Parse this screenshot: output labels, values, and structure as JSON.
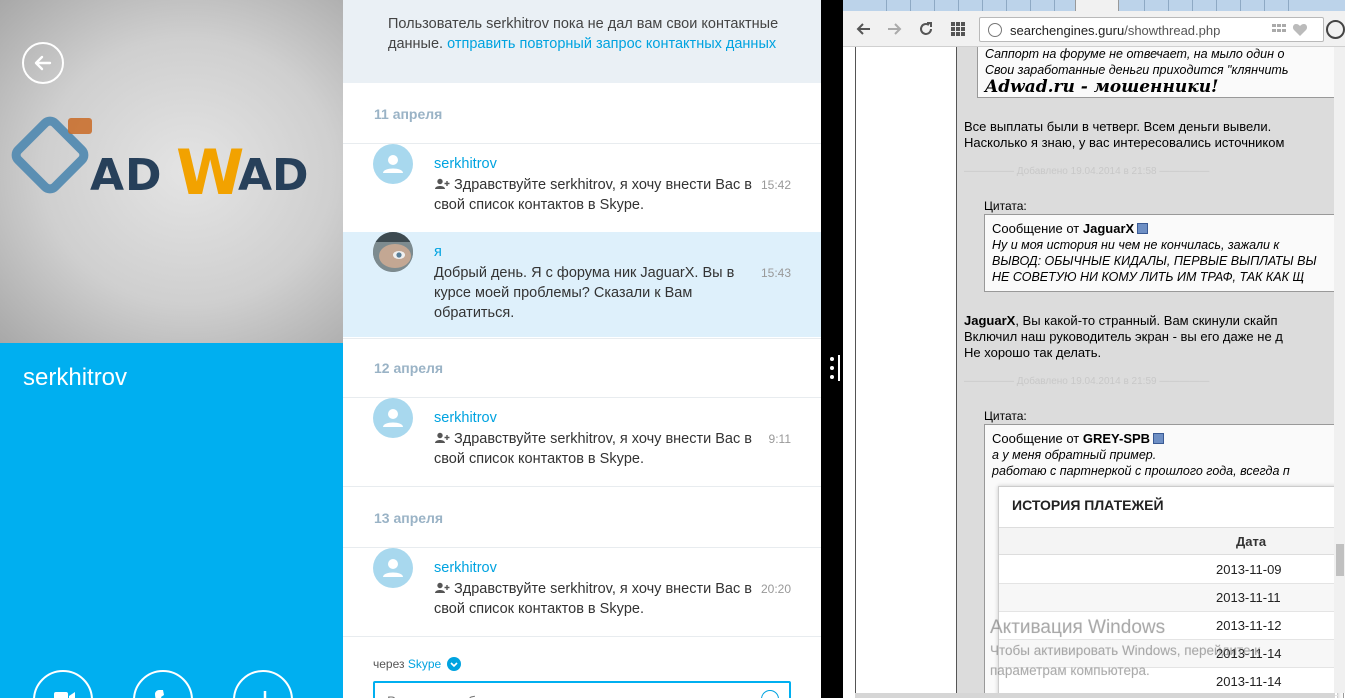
{
  "contact": {
    "name": "serkhitrov",
    "photo_logo_text": "ADWAD"
  },
  "chat": {
    "notice_text": "Пользователь serkhitrov пока не дал вам свои контактные данные.",
    "notice_link": "отправить повторный запрос контактных данных",
    "groups": [
      {
        "date": "11 апреля",
        "messages": [
          {
            "sender": "serkhitrov",
            "text": "Здравствуйте serkhitrov, я хочу внести Вас в свой список контактов в Skype.",
            "time": "15:42"
          },
          {
            "sender": "я",
            "text": "Добрый день. Я с форума ник JaguarX. Вы в курсе моей проблемы? Сказали к Вам обратиться.",
            "time": "15:43"
          }
        ]
      },
      {
        "date": "12 апреля",
        "messages": [
          {
            "sender": "serkhitrov",
            "text": "Здравствуйте serkhitrov, я хочу внести Вас в свой список контактов в Skype.",
            "time": "9:11"
          }
        ]
      },
      {
        "date": "13 апреля",
        "messages": [
          {
            "sender": "serkhitrov",
            "text": "Здравствуйте serkhitrov, я хочу внести Вас в свой список контактов в Skype.",
            "time": "20:20"
          }
        ]
      }
    ],
    "via_label": "через",
    "via_service": "Skype",
    "input_placeholder": "Введите сообщение"
  },
  "browser": {
    "url_domain": "searchengines.guru",
    "url_path": "/showthread.php",
    "post1_line1": "Саппорт на форуме не отвечает, на мыло один о",
    "post1_line2": "Свои заработанные деньги приходится \"клянчить",
    "post1_headline": "Adwad.ru - мошенники!",
    "post2_line1": "Все выплаты были в четверг. Всем деньги вывели.",
    "post2_line2": "Насколько я знаю, у вас интересовались источником",
    "divider1": "Добавлено 19.04.2014 в 21:58",
    "quote_label": "Цитата:",
    "quote1_header_prefix": "Сообщение от",
    "quote1_author": "JaguarX",
    "quote1_line1": "Ну и моя история ни чем не кончилась, зажали к",
    "quote1_line2": "ВЫВОД: ОБЫЧНЫЕ КИДАЛЫ, ПЕРВЫЕ ВЫПЛАТЫ ВЫ",
    "quote1_line3": "НЕ СОВЕТУЮ НИ КОМУ ЛИТЬ ИМ ТРАФ, ТАК КАК Щ",
    "post3_name": "JaguarX",
    "post3_line1_rest": ", Вы какой-то странный. Вам скинули скайп",
    "post3_line2": "Включил наш руководитель экран - вы его даже не д",
    "post3_line3": "Не хорошо так делать.",
    "divider2": "Добавлено 19.04.2014 в 21:59",
    "quote2_header_prefix": "Сообщение от",
    "quote2_author": "GREY-SPB",
    "quote2_line1": "а у меня обратный пример.",
    "quote2_line2": "работаю с партнеркой с прошлого года, всегда п",
    "payments": {
      "title": "ИСТОРИЯ ПЛАТЕЖЕЙ",
      "column": "Дата",
      "rows": [
        "2013-11-09",
        "2013-11-11",
        "2013-11-12",
        "2013-11-14",
        "2013-11-14"
      ]
    },
    "activation_title": "Активация Windows",
    "activation_sub1": "Чтобы активировать Windows, перейдите к",
    "activation_sub2": "параметрам компьютера."
  },
  "colors": {
    "skype_blue": "#00aff0",
    "link_blue": "#00a3e0",
    "own_message_bg": "#def0fb",
    "adwad_orange": "#f2a200",
    "adwad_navy": "#27405a"
  }
}
